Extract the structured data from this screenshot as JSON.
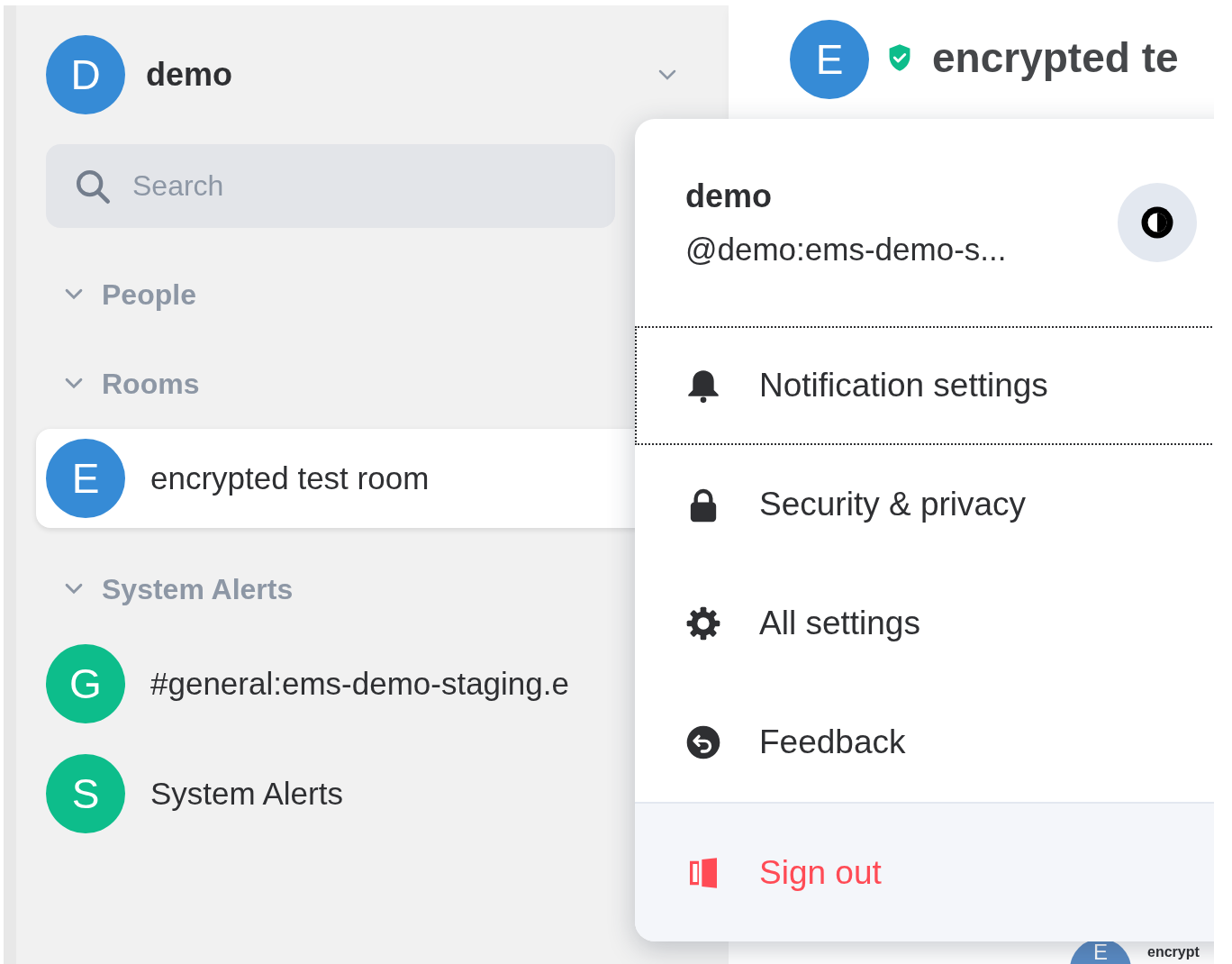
{
  "account": {
    "avatar": "D",
    "name": "demo"
  },
  "search": {
    "placeholder": "Search"
  },
  "sections": [
    {
      "title": "People",
      "expanded": true
    },
    {
      "title": "Rooms",
      "expanded": true,
      "rooms": [
        {
          "avatar": "E",
          "name": "encrypted test room",
          "color": "#368bd6",
          "selected": true
        }
      ]
    },
    {
      "title": "System Alerts",
      "expanded": true,
      "rooms": [
        {
          "avatar": "G",
          "name": "#general:ems-demo-staging.e",
          "color": "#0dbd8b",
          "selected": false
        },
        {
          "avatar": "S",
          "name": "System Alerts",
          "color": "#0dbd8b",
          "selected": false
        }
      ]
    }
  ],
  "room_header": {
    "avatar": "E",
    "title": "encrypted te",
    "encrypted": true
  },
  "timeline_peek": {
    "avatar": "E",
    "sender": "encrypt"
  },
  "user_menu": {
    "name": "demo",
    "user_id": "@demo:ems-demo-s...",
    "items": [
      {
        "kind": "notifications",
        "label": "Notification settings",
        "focused": true
      },
      {
        "kind": "security",
        "label": "Security & privacy",
        "focused": false
      },
      {
        "kind": "settings",
        "label": "All settings",
        "focused": false
      },
      {
        "kind": "feedback",
        "label": "Feedback",
        "focused": false
      }
    ],
    "sign_out": {
      "label": "Sign out"
    }
  }
}
